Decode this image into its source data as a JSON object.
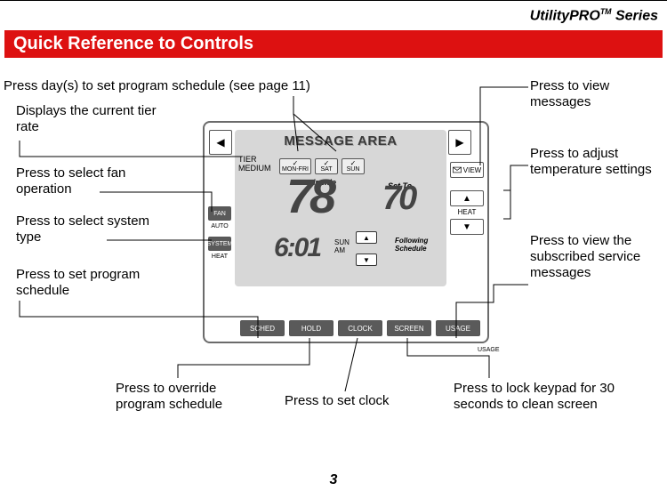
{
  "series": {
    "name": "UtilityPRO",
    "tm": "TM",
    "suffix": " Series"
  },
  "heading": "Quick Reference to Controls",
  "page": "3",
  "device": {
    "msg_area": "MESSAGE AREA",
    "nav_left": "◀",
    "nav_right": "▶",
    "view": "VIEW",
    "tier_label": "TIER",
    "tier_value": "MEDIUM",
    "days": {
      "monfri": "MON-FRI",
      "sat": "SAT",
      "sun": "SUN"
    },
    "inside": "Inside",
    "temp_current": "78",
    "setto": "Set To",
    "temp_set": "70",
    "heat": "HEAT",
    "fan_btn": "FAN",
    "auto": "AUTO",
    "system_btn": "SYSTEM",
    "heat_small": "HEAT",
    "clock": "6:01",
    "day_ind": "SUN",
    "ampm": "AM",
    "usage": "USAGE",
    "following": "Following Schedule",
    "bottom": {
      "sched": "SCHED",
      "hold": "HOLD",
      "clock": "CLOCK",
      "screen": "SCREEN",
      "usage": "USAGE"
    }
  },
  "callouts": {
    "days": "Press day(s) to set program schedule (see page 11)",
    "tier": "Displays the current tier rate",
    "fan": "Press to select fan operation",
    "system": "Press to select system type",
    "sched": "Press to set program schedule",
    "hold": "Press to override program schedule",
    "clock": "Press to set clock",
    "screen": "Press to lock keypad for 30 seconds to clean screen",
    "view_msg": "Press to view messages",
    "temp": "Press to adjust temperature settings",
    "sub_msg": "Press to view the subscribed service messages",
    "usage_btn": ""
  }
}
